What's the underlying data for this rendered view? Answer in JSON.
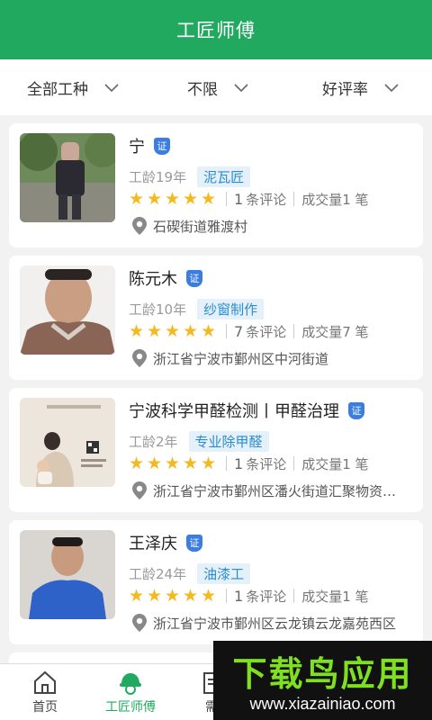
{
  "header": {
    "title": "工匠师傅"
  },
  "filters": [
    {
      "label": "全部工种"
    },
    {
      "label": "不限"
    },
    {
      "label": "好评率"
    }
  ],
  "workers": [
    {
      "name": "宁",
      "cert": "证",
      "years": "工龄19年",
      "trade": "泥瓦匠",
      "reviews_count": "1",
      "reviews_unit": "条评论",
      "deals_text": "成交量1 笔",
      "address": "石碶街道雅渡村",
      "rating": 5
    },
    {
      "name": "陈元木",
      "cert": "证",
      "years": "工龄10年",
      "trade": "纱窗制作",
      "reviews_count": "7",
      "reviews_unit": "条评论",
      "deals_text": "成交量7 笔",
      "address": "浙江省宁波市鄞州区中河街道",
      "rating": 5
    },
    {
      "name": "宁波科学甲醛检测丨甲醛治理",
      "cert": "证",
      "years": "工龄2年",
      "trade": "专业除甲醛",
      "reviews_count": "1",
      "reviews_unit": "条评论",
      "deals_text": "成交量1 笔",
      "address": "浙江省宁波市鄞州区潘火街道汇聚物资…",
      "rating": 5
    },
    {
      "name": "王泽庆",
      "cert": "证",
      "years": "工龄24年",
      "trade": "油漆工",
      "reviews_count": "1",
      "reviews_unit": "条评论",
      "deals_text": "成交量1 笔",
      "address": "浙江省宁波市鄞州区云龙镇云龙嘉苑西区",
      "rating": 5
    }
  ],
  "tabbar": {
    "home": "首页",
    "craftsmen": "工匠师傅",
    "demand": "需"
  },
  "watermark": {
    "title": "下载鸟应用",
    "url": "www.xiazainiao.com"
  },
  "colors": {
    "brand": "#21aa5f",
    "star": "#f6b81f",
    "tag_bg": "#e4f1fb",
    "tag_text": "#2b8bd0",
    "cert": "#3b7de0"
  }
}
